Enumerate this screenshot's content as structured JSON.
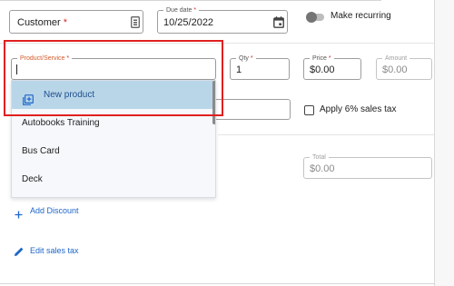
{
  "customer": {
    "label": "Customer",
    "required_mark": "*"
  },
  "due_date": {
    "label": "Due date",
    "required_mark": "*",
    "value": "10/25/2022"
  },
  "recurring": {
    "label": "Make recurring",
    "on": false
  },
  "line_item": {
    "product": {
      "label": "Product/Service",
      "required_mark": "*",
      "value": ""
    },
    "qty": {
      "label": "Qty",
      "required_mark": "*",
      "value": "1"
    },
    "price": {
      "label": "Price",
      "required_mark": "*",
      "value": "$0.00"
    },
    "amount": {
      "label": "Amount",
      "value": "$0.00"
    }
  },
  "dropdown": {
    "new_product_label": "New product",
    "options": [
      "Autobooks Training",
      "Bus Card",
      "Deck"
    ]
  },
  "tax": {
    "checkbox_label": "Apply 6% sales tax",
    "checked": false
  },
  "total": {
    "label": "Total",
    "value": "$0.00"
  },
  "add_discount_label": "Add Discount",
  "edit_sales_tax_label": "Edit sales tax",
  "colors": {
    "highlight_border": "#e02020",
    "accent": "#1e66c9",
    "selected_bg": "#b9d6e9"
  },
  "icons": {
    "calendar": "calendar-icon",
    "contact_card": "contact-card-icon",
    "plus": "plus-icon",
    "pencil": "pencil-icon",
    "new_product": "add-box-icon"
  }
}
